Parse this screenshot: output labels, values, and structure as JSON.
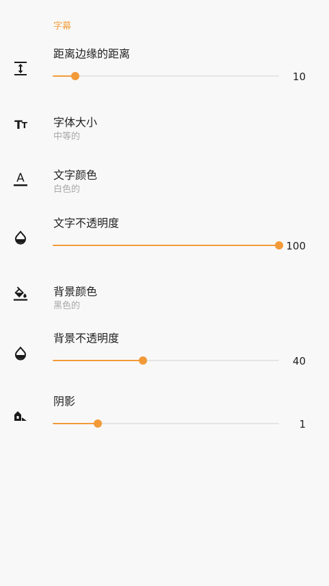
{
  "section": {
    "title": "字幕"
  },
  "items": {
    "margin": {
      "title": "距离边缘的距离",
      "value": "10",
      "progress": 0.1,
      "icon": "vertical-align-icon"
    },
    "font_size": {
      "title": "字体大小",
      "summary": "中等的",
      "icon": "text-size-icon"
    },
    "text_color": {
      "title": "文字颜色",
      "summary": "白色的",
      "icon": "text-color-icon"
    },
    "text_opacity": {
      "title": "文字不透明度",
      "value": "100",
      "progress": 1.0,
      "icon": "opacity-drop-icon"
    },
    "bg_color": {
      "title": "背景颜色",
      "summary": "黑色的",
      "icon": "fill-color-icon"
    },
    "bg_opacity": {
      "title": "背景不透明度",
      "value": "40",
      "progress": 0.4,
      "icon": "opacity-drop-icon"
    },
    "shadow": {
      "title": "阴影",
      "value": "1",
      "progress": 0.2,
      "icon": "shadow-icon"
    }
  },
  "colors": {
    "accent": "#f29a38",
    "header": "#f0a03c",
    "secondary_text": "#a8a8a8"
  }
}
